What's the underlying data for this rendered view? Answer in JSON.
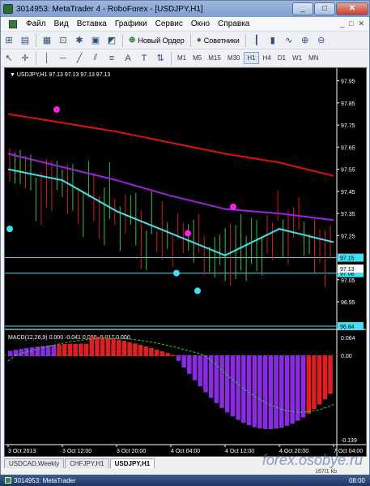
{
  "window": {
    "title": "3014953: MetaTrader 4 - RoboForex - [USDJPY,H1]",
    "controls": [
      "_",
      "□",
      "✕"
    ]
  },
  "menu": {
    "items": [
      "Файл",
      "Вид",
      "Вставка",
      "Графики",
      "Сервис",
      "Окно",
      "Справка"
    ],
    "doc_controls": [
      "_",
      "□",
      "✕"
    ]
  },
  "toolbar": {
    "new_order": "Новый Ордер",
    "advisors": "Советники",
    "timeframes": [
      "M1",
      "M5",
      "M15",
      "M30",
      "H1",
      "H4",
      "D1",
      "W1",
      "MN"
    ],
    "active_timeframe": "H1"
  },
  "chart": {
    "header": "USDJPY,H1  97.13 97.13 97.13 97.13",
    "price_ticks": [
      "97.95",
      "97.85",
      "97.75",
      "97.65",
      "97.55",
      "97.45",
      "97.35",
      "97.25",
      "97.05",
      "96.95"
    ],
    "price_labels": {
      "current": "97.13",
      "line1": "97.15",
      "line2": "97.08",
      "line3": "96.84"
    },
    "macd_header": "MACD(12,26,9) 0.000 -0.041 0.000 -0.017 0.000",
    "macd_ticks": [
      "0.064",
      "0.00",
      "-0.139"
    ],
    "time_ticks": [
      "3 Oct 2013",
      "3 Oct 12:00",
      "3 Oct 20:00",
      "4 Oct 04:00",
      "4 Oct 12:00",
      "4 Oct 20:00",
      "7 Oct 04:00"
    ],
    "colors": {
      "red_ma": "#e01010",
      "purple_ma": "#a020e0",
      "cyan_ma": "#40e0f0",
      "bull": "#40c040",
      "bear": "#d02020",
      "macd_pos": "#e02020",
      "macd_neg": "#8a2be2",
      "signal": "#30d030"
    }
  },
  "chart_data": {
    "type": "line",
    "title": "USDJPY,H1",
    "x": [
      "3 Oct 2013",
      "3 Oct 12:00",
      "3 Oct 20:00",
      "4 Oct 04:00",
      "4 Oct 12:00",
      "4 Oct 20:00",
      "7 Oct 04:00"
    ],
    "series": [
      {
        "values": [
          97.8,
          97.76,
          97.72,
          97.67,
          97.62,
          97.58,
          97.52
        ]
      },
      {
        "values": [
          97.62,
          97.56,
          97.5,
          97.43,
          97.37,
          97.35,
          97.32
        ]
      },
      {
        "values": [
          97.55,
          97.5,
          97.36,
          97.26,
          97.16,
          97.28,
          97.22
        ]
      }
    ],
    "ylim": [
      96.84,
      98.0
    ]
  },
  "tabs": [
    "USDCAD,Weekly",
    "CHFJPY,H1",
    "USDJPY,H1"
  ],
  "active_tab": "USDJPY,H1",
  "watermark": "forex.osobye.ru",
  "status": "167/1 kb",
  "taskbar": {
    "app": "3014953: MetaTrader",
    "clock": "08:00"
  }
}
